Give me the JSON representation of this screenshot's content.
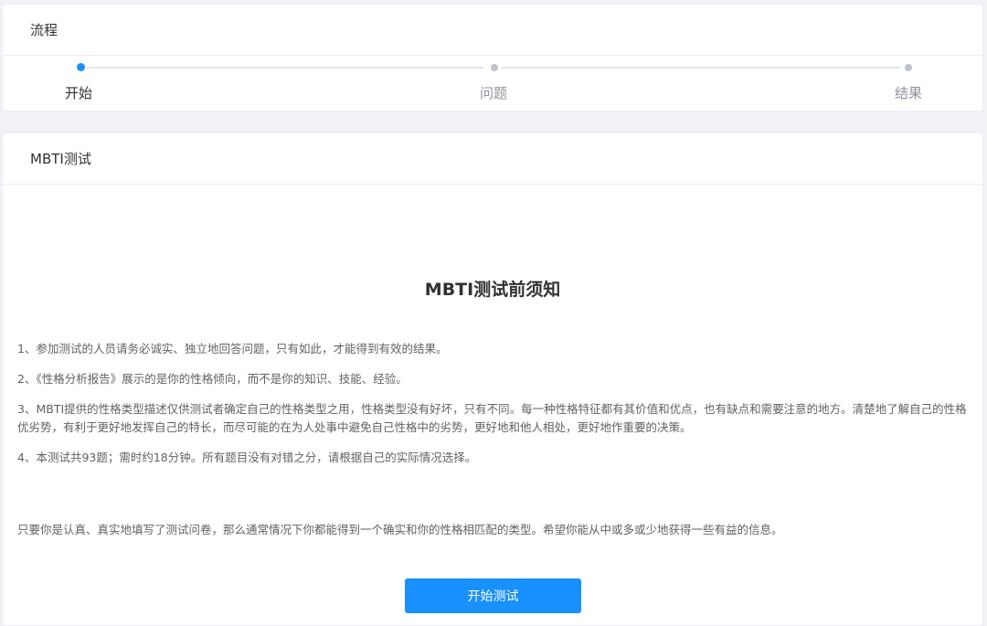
{
  "process": {
    "title": "流程",
    "steps": [
      {
        "label": "开始",
        "status": "active"
      },
      {
        "label": "问题",
        "status": "pending"
      },
      {
        "label": "结果",
        "status": "pending"
      }
    ]
  },
  "mbti": {
    "card_title": "MBTI测试",
    "notice_title": "MBTI测试前须知",
    "items": [
      "1、参加测试的人员请务必诚实、独立地回答问题，只有如此，才能得到有效的结果。",
      "2、《性格分析报告》展示的是你的性格倾向，而不是你的知识、技能、经验。",
      "3、MBTI提供的性格类型描述仅供测试者确定自己的性格类型之用，性格类型没有好坏，只有不同。每一种性格特征都有其价值和优点，也有缺点和需要注意的地方。清楚地了解自己的性格优劣势，有利于更好地发挥自己的特长，而尽可能的在为人处事中避免自己性格中的劣势，更好地和他人相处，更好地作重要的决策。",
      "4、本测试共93题；需时约18分钟。所有题目没有对错之分，请根据自己的实际情况选择。"
    ],
    "summary": "只要你是认真、真实地填写了测试问卷，那么通常情况下你都能得到一个确实和你的性格相匹配的类型。希望你能从中或多或少地获得一些有益的信息。",
    "start_button_label": "开始测试"
  },
  "colors": {
    "accent": "#1890ff",
    "pending": "#c0c4cc",
    "background": "#f0f2f5"
  }
}
